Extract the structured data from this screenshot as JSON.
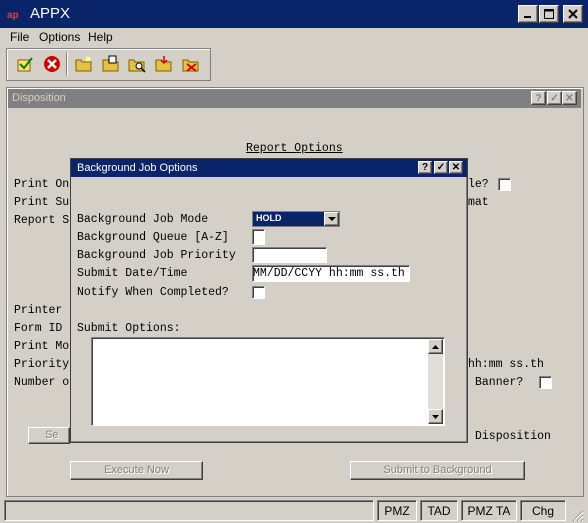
{
  "app": {
    "title": "APPX",
    "logo": "appx-logo-icon"
  },
  "window_controls": {
    "minimize": "minimize-icon",
    "maximize": "maximize-icon",
    "close": "close-icon"
  },
  "menu": {
    "items": [
      "File",
      "Options",
      "Help"
    ]
  },
  "toolbar": {
    "icons": [
      "check-mark-icon",
      "cancel-icon",
      "folder-icon-1",
      "folder-icon-2",
      "folder-search-icon",
      "folder-icon-3",
      "folder-delete-icon"
    ]
  },
  "disposition": {
    "title": "Disposition",
    "heading": "Report Options",
    "left_labels": [
      "Print On",
      "Print Su",
      "Report S",
      "Printer",
      "Form ID",
      "Print Mo",
      "Priority",
      "Number o"
    ],
    "right_fragments": [
      "le?",
      "mat",
      "hh:mm ss.th",
      "Banner?",
      "Disposition"
    ],
    "button_se": "Se",
    "execute_now": "Execute Now",
    "submit_to_background": "Submit to Background"
  },
  "bjo": {
    "title": "Background Job Options",
    "labels": {
      "mode": "Background Job Mode",
      "queue": "Background Queue [A-Z]",
      "priority": "Background Job Priority",
      "submit_dt": "Submit Date/Time",
      "notify": "Notify When Completed?",
      "submit_options": "Submit Options:"
    },
    "mode_value": "HOLD",
    "queue_value": "",
    "priority_value": "",
    "submit_dt_value": "MM/DD/CCYY hh:mm ss.th",
    "submit_options_value": ""
  },
  "status": {
    "cells": [
      "PMZ",
      "TAD",
      "PMZ TA",
      "Chg"
    ]
  },
  "colors": {
    "titlebar": "#0a246a",
    "face": "#d4d0c8",
    "inactive_title": "#808080"
  }
}
